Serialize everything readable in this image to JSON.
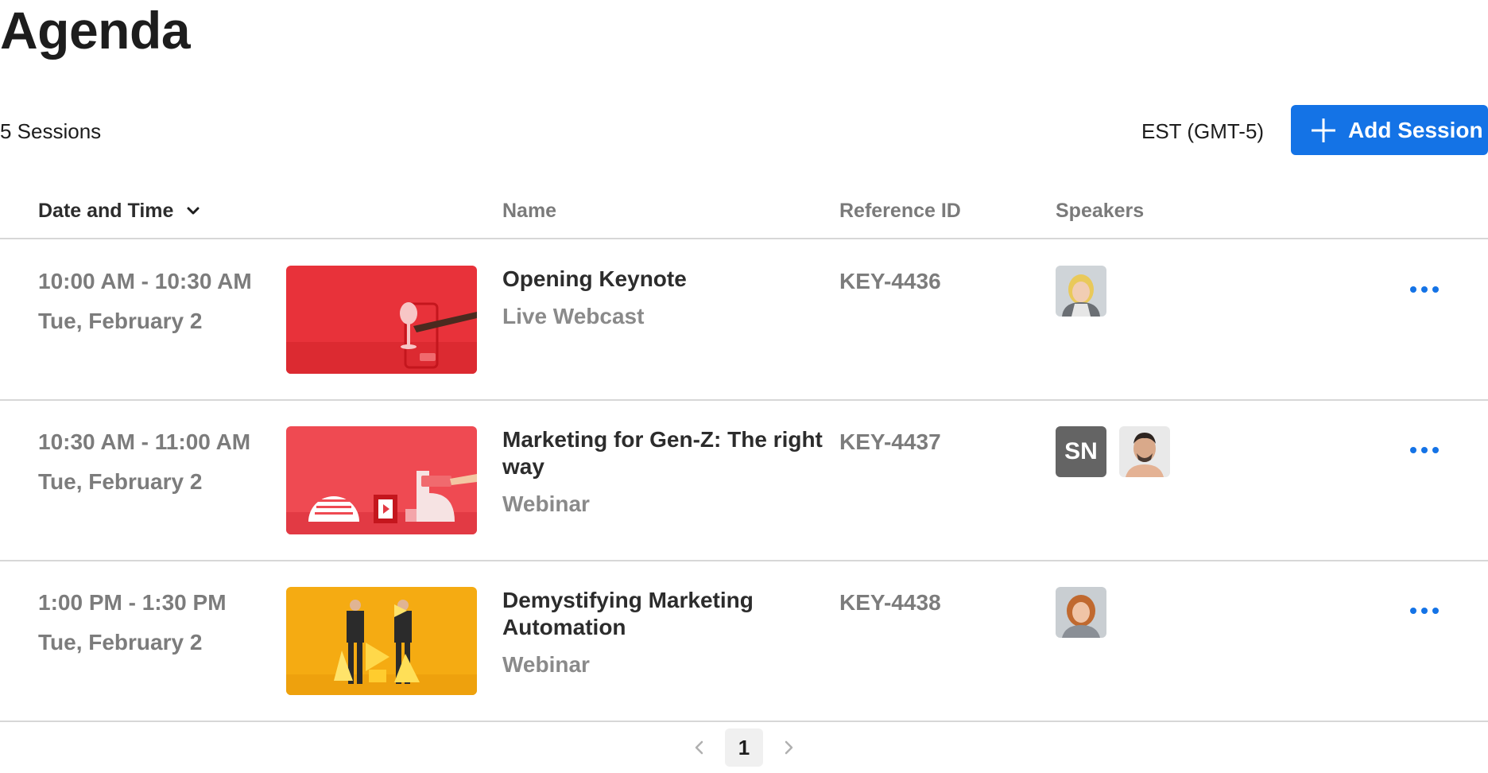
{
  "page": {
    "title": "Agenda",
    "session_count": "5 Sessions",
    "timezone": "EST (GMT-5)",
    "add_button_label": "Add Session"
  },
  "table": {
    "columns": {
      "date_time": "Date and Time",
      "name": "Name",
      "reference_id": "Reference ID",
      "speakers": "Speakers"
    },
    "rows": [
      {
        "time": "10:00 AM - 10:30 AM",
        "date": "Tue, February 2",
        "name": "Opening Keynote",
        "type": "Live Webcast",
        "reference_id": "KEY-4436",
        "speakers": [
          {
            "kind": "photo",
            "icon": "woman-blonde-avatar"
          }
        ]
      },
      {
        "time": "10:30 AM - 11:00 AM",
        "date": "Tue, February 2",
        "name": "Marketing for Gen-Z: The right way",
        "type": "Webinar",
        "reference_id": "KEY-4437",
        "speakers": [
          {
            "kind": "initials",
            "text": "SN"
          },
          {
            "kind": "photo",
            "icon": "man-avatar"
          }
        ]
      },
      {
        "time": "1:00 PM - 1:30 PM",
        "date": "Tue, February 2",
        "name": "Demystifying Marketing Automation",
        "type": "Webinar",
        "reference_id": "KEY-4438",
        "speakers": [
          {
            "kind": "photo",
            "icon": "woman-redhead-avatar"
          }
        ]
      }
    ]
  },
  "pagination": {
    "current_page": "1"
  },
  "colors": {
    "accent": "#1473e6",
    "divider": "#d7d7d7",
    "muted_text": "#7c7c7c",
    "initials_bg": "#646464"
  }
}
